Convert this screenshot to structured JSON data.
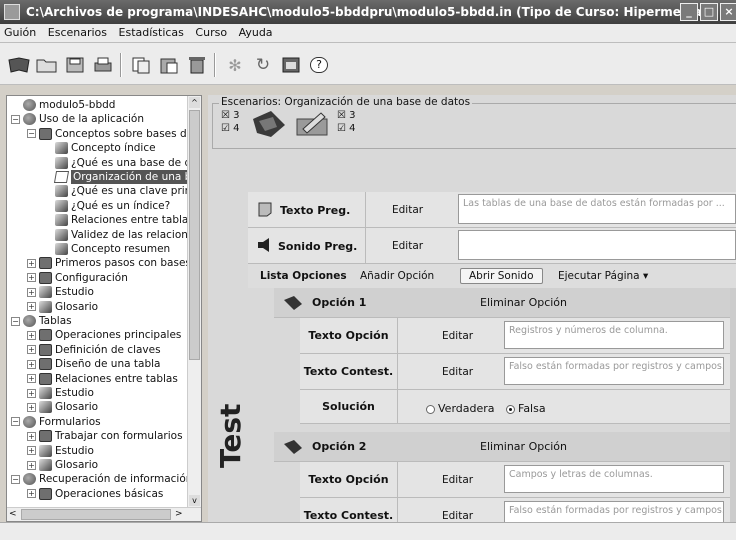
{
  "window": {
    "title": "C:\\Archivos de programa\\INDESAHC\\modulo5-bbddpru\\modulo5-bbdd.in (Tipo de Curso: Hipermedia) - INDESAHC"
  },
  "menu": [
    "Guión",
    "Escenarios",
    "Estadísticas",
    "Curso",
    "Ayuda"
  ],
  "toolbar_icons": [
    "book-icon",
    "folder-open-icon",
    "save-icon",
    "print-icon",
    "copy-icon",
    "paste-icon",
    "trash-icon",
    "sparkle-icon",
    "refresh-icon",
    "window-icon",
    "help-icon"
  ],
  "tree": [
    {
      "label": "modulo5-bbdd",
      "level": 0,
      "pm": "",
      "icon": "grp"
    },
    {
      "label": "Uso de la aplicación",
      "level": 0,
      "pm": "−",
      "icon": "grp"
    },
    {
      "label": "Conceptos sobre bases de",
      "level": 1,
      "pm": "−",
      "icon": "book"
    },
    {
      "label": "Concepto índice",
      "level": 2,
      "pm": "",
      "icon": "tool"
    },
    {
      "label": "¿Qué es una base de d",
      "level": 2,
      "pm": "",
      "icon": "tool"
    },
    {
      "label": "Organización de una ba",
      "level": 2,
      "pm": "",
      "icon": "page",
      "selected": true
    },
    {
      "label": "¿Qué es una clave prim",
      "level": 2,
      "pm": "",
      "icon": "tool"
    },
    {
      "label": "¿Qué es un índice?",
      "level": 2,
      "pm": "",
      "icon": "tool"
    },
    {
      "label": "Relaciones entre tablas",
      "level": 2,
      "pm": "",
      "icon": "tool"
    },
    {
      "label": "Validez de las relacione",
      "level": 2,
      "pm": "",
      "icon": "tool"
    },
    {
      "label": "Concepto resumen",
      "level": 2,
      "pm": "",
      "icon": "tool"
    },
    {
      "label": "Primeros pasos con bases d",
      "level": 1,
      "pm": "+",
      "icon": "book"
    },
    {
      "label": "Configuración",
      "level": 1,
      "pm": "+",
      "icon": "book"
    },
    {
      "label": "Estudio",
      "level": 1,
      "pm": "+",
      "icon": "tool"
    },
    {
      "label": "Glosario",
      "level": 1,
      "pm": "+",
      "icon": "tool"
    },
    {
      "label": "Tablas",
      "level": 0,
      "pm": "−",
      "icon": "grp"
    },
    {
      "label": "Operaciones principales",
      "level": 1,
      "pm": "+",
      "icon": "book"
    },
    {
      "label": "Definición de claves",
      "level": 1,
      "pm": "+",
      "icon": "book"
    },
    {
      "label": "Diseño de una tabla",
      "level": 1,
      "pm": "+",
      "icon": "book"
    },
    {
      "label": "Relaciones entre tablas",
      "level": 1,
      "pm": "+",
      "icon": "book"
    },
    {
      "label": "Estudio",
      "level": 1,
      "pm": "+",
      "icon": "tool"
    },
    {
      "label": "Glosario",
      "level": 1,
      "pm": "+",
      "icon": "tool"
    },
    {
      "label": "Formularios",
      "level": 0,
      "pm": "−",
      "icon": "grp"
    },
    {
      "label": "Trabajar con formularios",
      "level": 1,
      "pm": "+",
      "icon": "book"
    },
    {
      "label": "Estudio",
      "level": 1,
      "pm": "+",
      "icon": "tool"
    },
    {
      "label": "Glosario",
      "level": 1,
      "pm": "+",
      "icon": "tool"
    },
    {
      "label": "Recuperación de información",
      "level": 0,
      "pm": "−",
      "icon": "grp"
    },
    {
      "label": "Operaciones básicas",
      "level": 1,
      "pm": "+",
      "icon": "book"
    }
  ],
  "escenarios": {
    "label": "Escenarios: Organización de una base de datos",
    "counts_left": [
      "3",
      "4"
    ],
    "counts_right": [
      "3",
      "4"
    ]
  },
  "side_label": "Test",
  "form": {
    "texto_preg": {
      "label": "Texto Preg.",
      "edit": "Editar",
      "value": "Las tablas de una base de datos están formadas por ..."
    },
    "sonido_preg": {
      "label": "Sonido Preg.",
      "edit": "Editar",
      "value": ""
    },
    "lista": {
      "label": "Lista Opciones",
      "add": "Añadir Opción",
      "open_sound": "Abrir Sonido",
      "run": "Ejecutar Página ▾"
    },
    "options": [
      {
        "title": "Opción 1",
        "delete": "Eliminar Opción",
        "texto_opcion_label": "Texto Opción",
        "texto_opcion_edit": "Editar",
        "texto_opcion_value": "Registros y números de columna.",
        "texto_contest_label": "Texto Contest.",
        "texto_contest_edit": "Editar",
        "texto_contest_value": "Falso están formadas por registros y campos.",
        "solucion_label": "Solución",
        "true_label": "Verdadera",
        "false_label": "Falsa"
      },
      {
        "title": "Opción 2",
        "delete": "Eliminar Opción",
        "texto_opcion_label": "Texto Opción",
        "texto_opcion_edit": "Editar",
        "texto_opcion_value": "Campos y letras de columnas.",
        "texto_contest_label": "Texto Contest.",
        "texto_contest_edit": "Editar",
        "texto_contest_value": "Falso están formadas por registros y campos."
      }
    ]
  }
}
